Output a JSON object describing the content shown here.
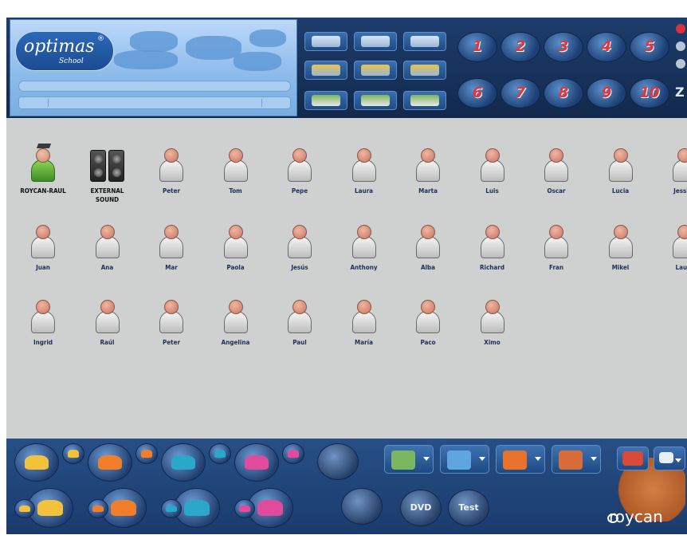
{
  "app": {
    "logo_text": "optimas",
    "logo_registered": "®",
    "logo_sub": "School"
  },
  "toolbar": {
    "buttons": [
      {
        "name": "video-monitor-button",
        "icon": "video-monitor-icon"
      },
      {
        "name": "video-group-button",
        "icon": "video-group-icon"
      },
      {
        "name": "video-control-button",
        "icon": "video-control-icon"
      },
      {
        "name": "audio-monitor-button",
        "icon": "audio-monitor-icon"
      },
      {
        "name": "audio-group-button",
        "icon": "audio-group-icon"
      },
      {
        "name": "audio-control-button",
        "icon": "audio-control-icon"
      },
      {
        "name": "student-view-button",
        "icon": "student-view-icon"
      },
      {
        "name": "student-list-button",
        "icon": "student-list-icon"
      },
      {
        "name": "student-tools-button",
        "icon": "student-tools-icon"
      }
    ]
  },
  "numbers": [
    "1",
    "2",
    "3",
    "4",
    "5",
    "6",
    "7",
    "8",
    "9",
    "10"
  ],
  "window_controls": {
    "close_icon": "close-icon",
    "z_label": "Z"
  },
  "students": {
    "rows": [
      [
        {
          "label": "ROYCAN-RAUL",
          "kind": "teacher"
        },
        {
          "label": "EXTERNAL SOUND",
          "kind": "sound"
        },
        {
          "label": "Peter",
          "kind": "student"
        },
        {
          "label": "Tom",
          "kind": "student"
        },
        {
          "label": "Pepe",
          "kind": "student"
        },
        {
          "label": "Laura",
          "kind": "student"
        },
        {
          "label": "Marta",
          "kind": "student"
        },
        {
          "label": "Luis",
          "kind": "student"
        },
        {
          "label": "Oscar",
          "kind": "student"
        },
        {
          "label": "Lucia",
          "kind": "student"
        },
        {
          "label": "Jessica",
          "kind": "student"
        }
      ],
      [
        {
          "label": "Juan",
          "kind": "student"
        },
        {
          "label": "Ana",
          "kind": "student"
        },
        {
          "label": "Mar",
          "kind": "student"
        },
        {
          "label": "Paola",
          "kind": "student"
        },
        {
          "label": "Jesús",
          "kind": "student"
        },
        {
          "label": "Anthony",
          "kind": "student"
        },
        {
          "label": "Alba",
          "kind": "student"
        },
        {
          "label": "Richard",
          "kind": "student"
        },
        {
          "label": "Fran",
          "kind": "student"
        },
        {
          "label": "Mikel",
          "kind": "student"
        },
        {
          "label": "Laura",
          "kind": "student"
        }
      ],
      [
        {
          "label": "Ingrid",
          "kind": "student"
        },
        {
          "label": "Raúl",
          "kind": "student"
        },
        {
          "label": "Peter",
          "kind": "student"
        },
        {
          "label": "Angelina",
          "kind": "student"
        },
        {
          "label": "Paul",
          "kind": "student"
        },
        {
          "label": "María",
          "kind": "student"
        },
        {
          "label": "Paco",
          "kind": "student"
        },
        {
          "label": "Ximo",
          "kind": "student"
        }
      ]
    ]
  },
  "bottom": {
    "group_colors": [
      "#f2c33a",
      "#f07e2b",
      "#2aa7c9",
      "#e24b9c"
    ],
    "action_buttons": [
      {
        "name": "group-users-button",
        "icon": "group-users-icon",
        "color": "#7bb660"
      },
      {
        "name": "screen-share-button",
        "icon": "screen-share-icon",
        "color": "#5fa5e0"
      },
      {
        "name": "refresh-button",
        "icon": "refresh-icon",
        "color": "#e8722c"
      },
      {
        "name": "class-layout-button",
        "icon": "class-layout-icon",
        "color": "#d86b3a"
      }
    ],
    "round_buttons": {
      "dvd_label": "DVD",
      "test_label": "Test"
    },
    "brand_text": "roycan"
  }
}
